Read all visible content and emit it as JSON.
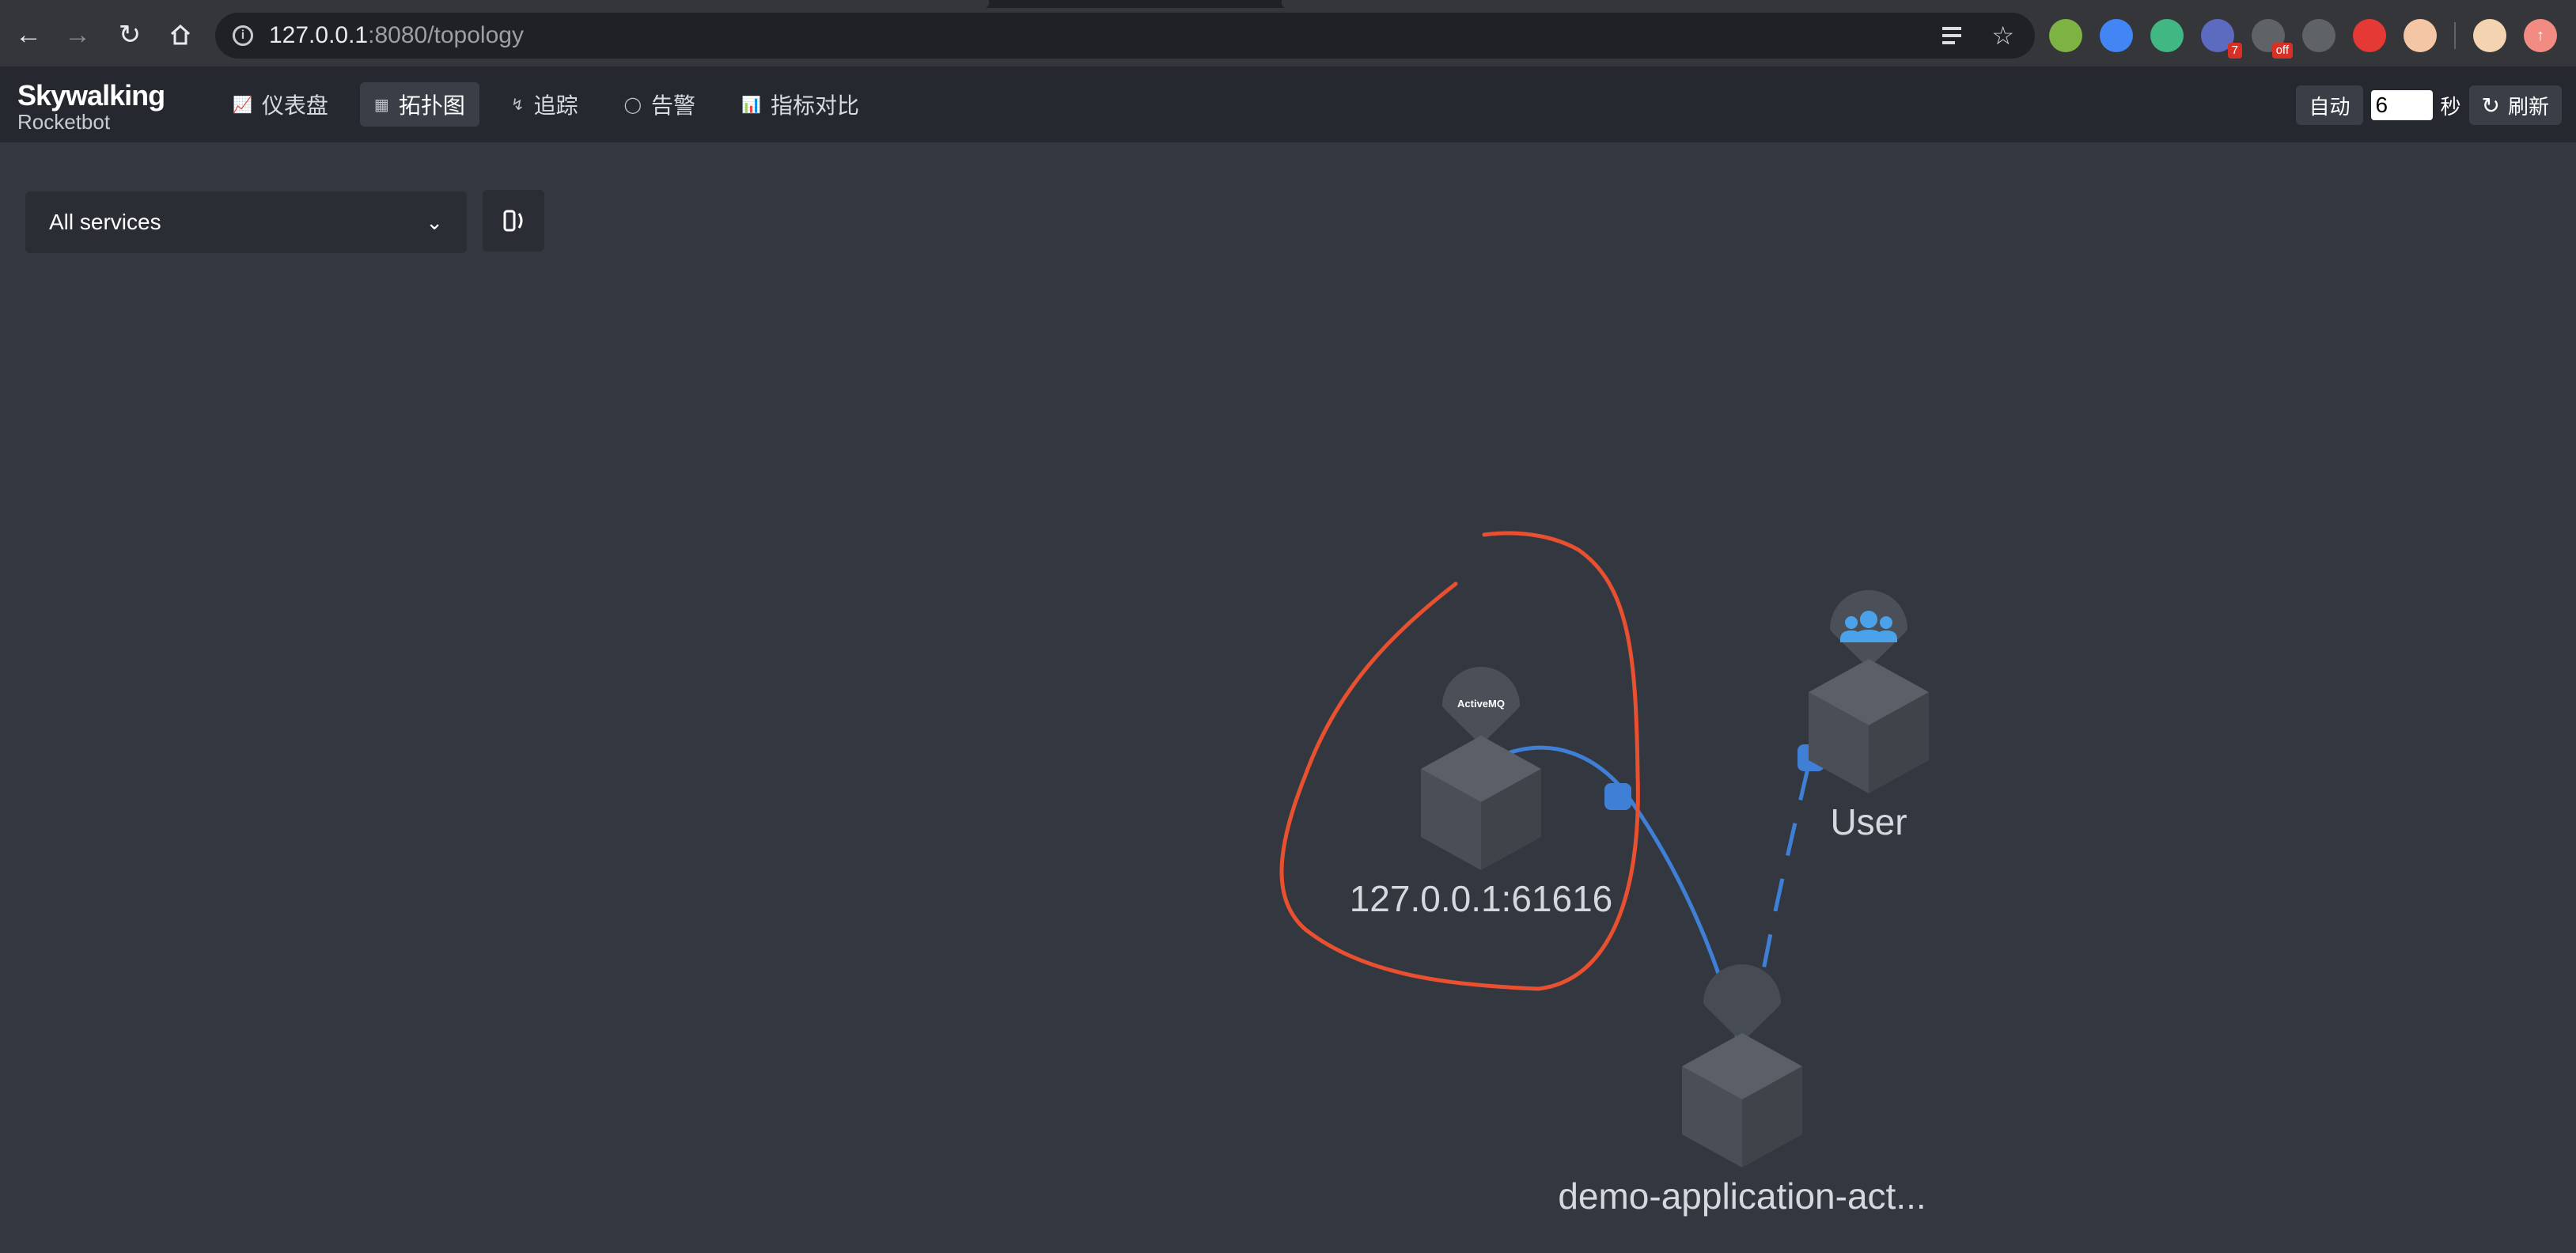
{
  "browser": {
    "url_host": "127.0.0.1",
    "url_rest": ":8080/topology",
    "extensions": [
      {
        "icon": "green-dot-extension-icon",
        "color": "#7cb342",
        "badge": ""
      },
      {
        "icon": "diamond-extension-icon",
        "color": "#4285f4",
        "badge": ""
      },
      {
        "icon": "vue-devtools-extension-icon",
        "color": "#41b883",
        "badge": ""
      },
      {
        "icon": "grid-extension-icon",
        "color": "#5c6bc0",
        "badge": "7"
      },
      {
        "icon": "list-extension-icon",
        "color": "#5f6368",
        "badge": "off"
      },
      {
        "icon": "eyedropper-extension-icon",
        "color": "#5f6368",
        "badge": ""
      },
      {
        "icon": "red-plug-extension-icon",
        "color": "#e53935",
        "badge": ""
      },
      {
        "icon": "face-extension-icon",
        "color": "#f5c6a5",
        "badge": ""
      }
    ]
  },
  "app": {
    "brand": "Skywalking",
    "sub": "Rocketbot",
    "nav": [
      {
        "label": "仪表盘",
        "icon": "chart-icon"
      },
      {
        "label": "拓扑图",
        "icon": "topology-icon",
        "active": true
      },
      {
        "label": "追踪",
        "icon": "trace-icon"
      },
      {
        "label": "告警",
        "icon": "alarm-icon"
      },
      {
        "label": "指标对比",
        "icon": "compare-icon"
      }
    ],
    "auto_label": "自动",
    "interval_value": "6",
    "sec_label": "秒",
    "refresh_label": "刷新"
  },
  "toolbar": {
    "service_select": "All services"
  },
  "topology": {
    "nodes": [
      {
        "name": "127.0.0.1:61616",
        "pin": "ActiveMQ"
      },
      {
        "name": "User",
        "pin": "users-icon"
      },
      {
        "name": "demo-application-act...",
        "pin": ""
      }
    ],
    "colors": {
      "link": "#3f7fd6",
      "annotation": "#e8502f",
      "cube_top": "#5b5f67",
      "cube_left": "#4a4e56",
      "cube_right": "#3f434a"
    }
  }
}
